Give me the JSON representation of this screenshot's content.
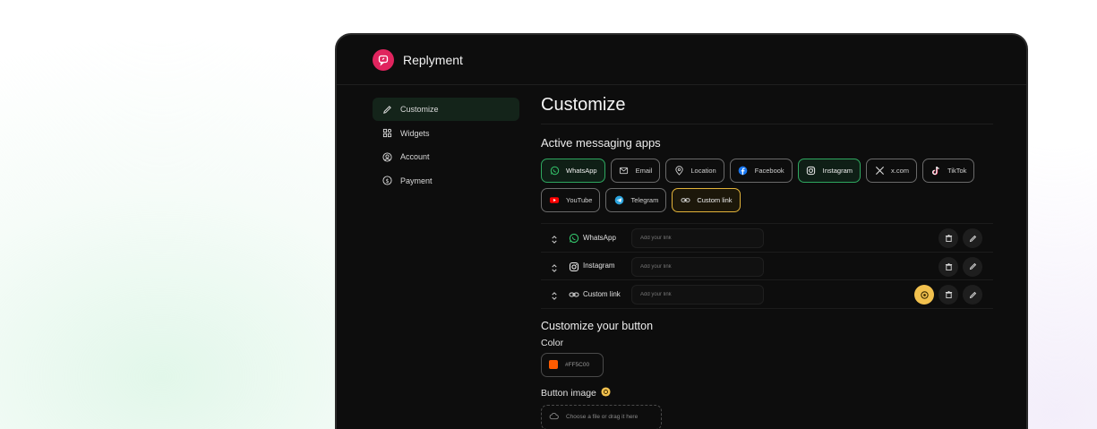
{
  "brand": {
    "name": "Replyment",
    "logo_color": "#e0245e"
  },
  "sidebar": {
    "items": [
      {
        "label": "Customize",
        "icon": "pencil-icon",
        "active": true
      },
      {
        "label": "Widgets",
        "icon": "widgets-icon"
      },
      {
        "label": "Account",
        "icon": "account-icon"
      },
      {
        "label": "Payment",
        "icon": "dollar-icon"
      }
    ]
  },
  "main": {
    "title": "Customize",
    "apps_heading": "Active messaging apps",
    "apps": [
      {
        "label": "WhatsApp",
        "icon": "whatsapp-icon",
        "state": "active"
      },
      {
        "label": "Email",
        "icon": "mail-icon"
      },
      {
        "label": "Location",
        "icon": "location-pin-icon"
      },
      {
        "label": "Facebook",
        "icon": "facebook-icon"
      },
      {
        "label": "Instagram",
        "icon": "instagram-icon",
        "state": "active"
      },
      {
        "label": "x.com",
        "icon": "x-icon"
      },
      {
        "label": "TikTok",
        "icon": "tiktok-icon"
      },
      {
        "label": "YouTube",
        "icon": "youtube-icon"
      },
      {
        "label": "Telegram",
        "icon": "telegram-icon"
      },
      {
        "label": "Custom link",
        "icon": "link-icon",
        "state": "selected"
      }
    ],
    "links": [
      {
        "label": "WhatsApp",
        "icon": "whatsapp-icon",
        "placeholder": "Add your link"
      },
      {
        "label": "Instagram",
        "icon": "instagram-icon",
        "placeholder": "Add your link"
      },
      {
        "label": "Custom link",
        "icon": "link-icon",
        "placeholder": "Add your link"
      }
    ],
    "button_heading": "Customize your button",
    "color_label": "Color",
    "color_value": "#FF5C00",
    "image_label": "Button image",
    "upload_text": "Choose a file or drag it here"
  },
  "colors": {
    "accent_green": "#2fa860",
    "accent_yellow": "#f2c14e"
  }
}
